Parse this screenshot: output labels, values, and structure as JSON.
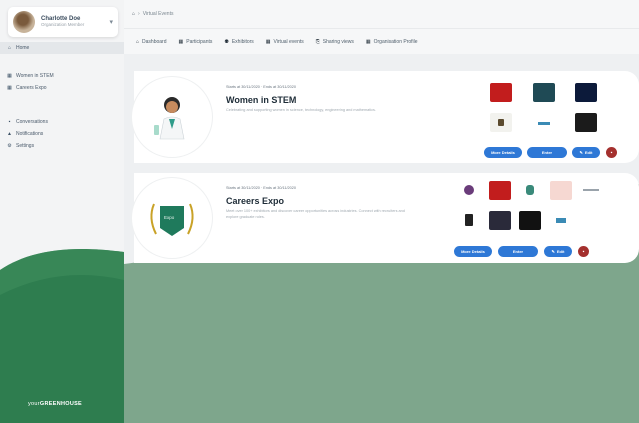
{
  "user": {
    "name": "Charlotte Doe",
    "subtitle": "Organization Member"
  },
  "sidebar": {
    "items": [
      {
        "label": "Home",
        "icon": "home-icon"
      },
      {
        "label": "Women in STEM",
        "icon": "grid-icon"
      },
      {
        "label": "Careers Expo",
        "icon": "grid-icon"
      },
      {
        "label": "Conversations",
        "icon": "chat-icon"
      },
      {
        "label": "Notifications",
        "icon": "bell-icon"
      },
      {
        "label": "Settings",
        "icon": "gear-icon"
      }
    ],
    "brand_prefix": "your",
    "brand_name": "GREENHOUSE"
  },
  "breadcrumb": "Virtual Events",
  "tabs": [
    {
      "label": "Dashboard",
      "icon": "home-icon"
    },
    {
      "label": "Participants",
      "icon": "grid-icon"
    },
    {
      "label": "Exhibitors",
      "icon": "users-icon"
    },
    {
      "label": "Virtual events",
      "icon": "grid-icon"
    },
    {
      "label": "Sharing views",
      "icon": "share-icon"
    },
    {
      "label": "Organisation Profile",
      "icon": "grid-icon"
    }
  ],
  "events": [
    {
      "date": "Starts at 30/11/2020 · Ends at 30/11/2020",
      "title": "Women in STEM",
      "description": "Celebrating and supporting women in science, technology, engineering and mathematics.",
      "buttons": {
        "more": "More Details",
        "enter": "Enter",
        "edit": "Edit"
      }
    },
    {
      "date": "Starts at 30/11/2020 · Ends at 30/11/2020",
      "title": "Careers Expo",
      "description": "Meet over 100+ exhibitors and discover career opportunities across industries. Connect with recruiters and explore graduate roles.",
      "badge": "Expo",
      "buttons": {
        "more": "More Details",
        "enter": "Enter",
        "edit": "Edit"
      }
    }
  ],
  "colors": {
    "accent": "#2e78d6",
    "brand_green": "#2e7d4f",
    "danger": "#a4302e"
  }
}
